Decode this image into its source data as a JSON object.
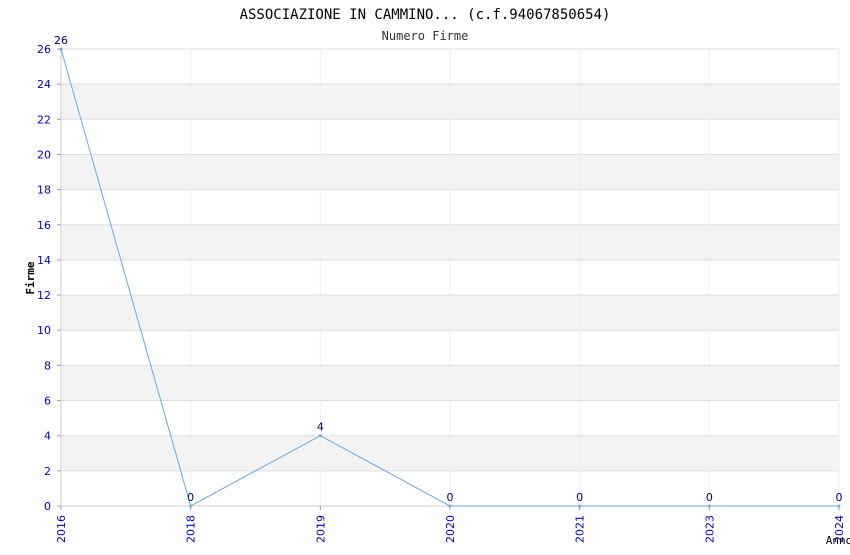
{
  "chart_data": {
    "type": "line",
    "title": "ASSOCIAZIONE IN CAMMINO... (c.f.94067850654)",
    "subtitle": "Numero Firme",
    "xlabel": "Anno",
    "ylabel": "Firme",
    "categories": [
      "2016",
      "2018",
      "2019",
      "2020",
      "2021",
      "2023",
      "2024"
    ],
    "series": [
      {
        "values": [
          26,
          0,
          4,
          0,
          0,
          0,
          0
        ]
      }
    ],
    "data_labels": [
      "26",
      "0",
      "4",
      "0",
      "0",
      "0",
      "0"
    ],
    "y_ticks": [
      0,
      2,
      4,
      6,
      8,
      10,
      12,
      14,
      16,
      18,
      20,
      22,
      24,
      26
    ],
    "ylim": [
      0,
      26
    ],
    "grid": true,
    "legend": "none",
    "colors": {
      "line": "#66aaee",
      "tick_text": "#0000cc",
      "label_text": "#000088",
      "band": "#f3f3f3",
      "grid": "#dddddd"
    }
  }
}
